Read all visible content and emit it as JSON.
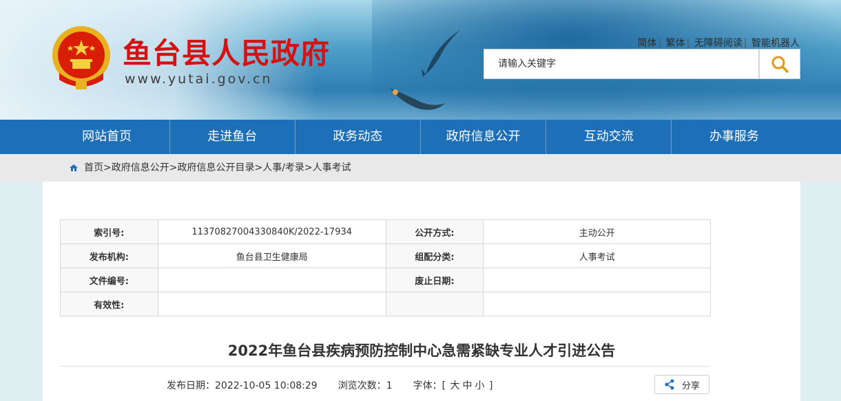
{
  "header": {
    "site_name": "鱼台县人民政府",
    "site_url": "www.yutai.gov.cn",
    "top_links": [
      "简体",
      "繁体",
      "无障碍阅读",
      "智能机器人"
    ],
    "search_placeholder": "请输入关键字"
  },
  "nav": {
    "items": [
      "网站首页",
      "走进鱼台",
      "政务动态",
      "政府信息公开",
      "互动交流",
      "办事服务"
    ]
  },
  "breadcrumb": {
    "items": [
      "首页",
      "政府信息公开",
      "政府信息公开目录",
      "人事/考录",
      "人事考试"
    ],
    "separator": ">"
  },
  "meta": {
    "index_label": "索引号:",
    "index_value": "11370827004330840K/2022-17934",
    "public_mode_label": "公开方式:",
    "public_mode_value": "主动公开",
    "publisher_label": "发布机构:",
    "publisher_value": "鱼台县卫生健康局",
    "category_label": "组配分类:",
    "category_value": "人事考试",
    "doc_number_label": "文件编号:",
    "doc_number_value": "",
    "expiry_label": "废止日期:",
    "expiry_value": "",
    "validity_label": "有效性:",
    "validity_value": ""
  },
  "article": {
    "title": "2022年鱼台县疾病预防控制中心急需紧缺专业人才引进公告",
    "publish_date_text": "发布日期：2022-10-05 10:08:29",
    "views_text": "浏览次数：1",
    "font_label": "字体：",
    "font_open": "[",
    "font_large": "大",
    "font_medium": "中",
    "font_small": "小",
    "font_close": "]",
    "share_label": "分享"
  },
  "colors": {
    "brand_red": "#d51212",
    "nav_blue": "#1d6fb8"
  }
}
